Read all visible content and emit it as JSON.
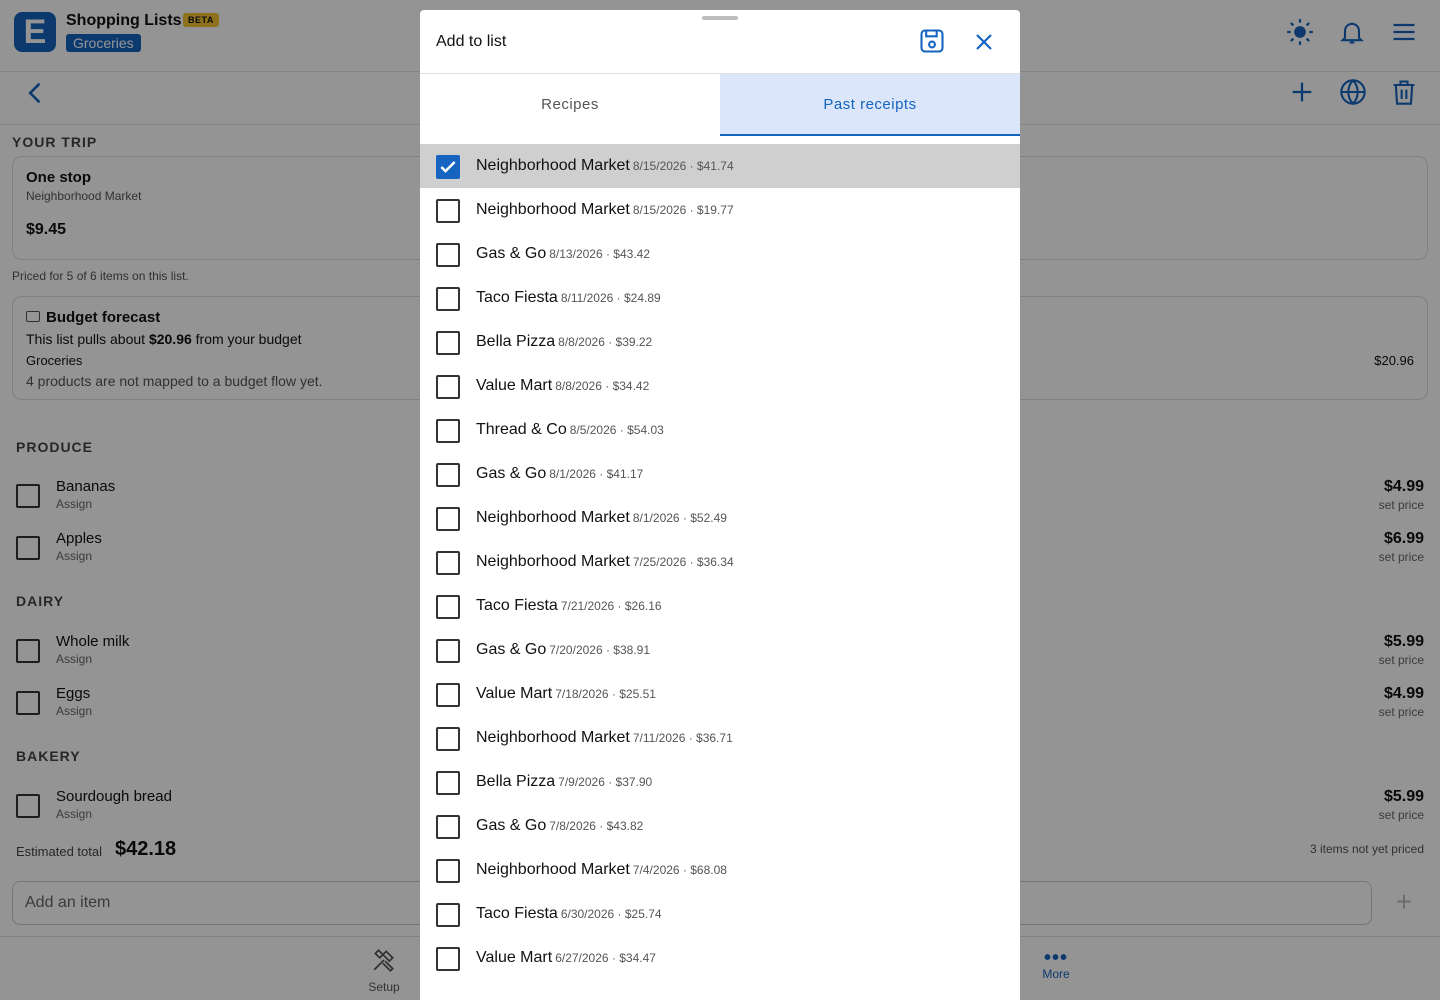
{
  "app": {
    "title": "Shopping Lists",
    "beta_label": "BETA",
    "list_name": "Groceries"
  },
  "trip": {
    "section_label": "YOUR TRIP",
    "title": "One stop",
    "store": "Neighborhood Market",
    "price": "$9.45",
    "priced_note": "Priced for 5 of 6 items on this list."
  },
  "budget": {
    "title": "Budget forecast",
    "line_prefix": "This list pulls about",
    "line_amount": "$20.96",
    "line_suffix": "from your budget",
    "category": "Groceries",
    "category_amount": "$20.96",
    "warning": "4 products are not mapped to a budget flow yet."
  },
  "categories": [
    {
      "label": "PRODUCE"
    },
    {
      "label": "DAIRY"
    },
    {
      "label": "BAKERY"
    }
  ],
  "items": [
    {
      "name": "Bananas",
      "assign": "Assign",
      "price": "$4.99",
      "price_note": "set price"
    },
    {
      "name": "Apples",
      "assign": "Assign",
      "price": "$6.99",
      "price_note": "set price"
    },
    {
      "name": "Whole milk",
      "assign": "Assign",
      "price": "$5.99",
      "price_note": "set price"
    },
    {
      "name": "Eggs",
      "assign": "Assign",
      "price": "$4.99",
      "price_note": "set price"
    },
    {
      "name": "Sourdough bread",
      "assign": "Assign",
      "price": "$5.99",
      "price_note": "set price"
    }
  ],
  "totals": {
    "estimated_label": "Estimated total",
    "estimated_value": "$42.18",
    "not_priced": "3 items not yet priced"
  },
  "add_item": {
    "placeholder": "Add an item"
  },
  "bottom_nav": {
    "setup": "Setup",
    "more": "More"
  },
  "modal": {
    "title": "Add to list",
    "tabs": [
      {
        "label": "Recipes",
        "active": false
      },
      {
        "label": "Past receipts",
        "active": true
      }
    ],
    "receipts": [
      {
        "store": "Neighborhood Market",
        "meta": "8/15/2026 · $41.74",
        "checked": true
      },
      {
        "store": "Neighborhood Market",
        "meta": "8/15/2026 · $19.77",
        "checked": false
      },
      {
        "store": "Gas & Go",
        "meta": "8/13/2026 · $43.42",
        "checked": false
      },
      {
        "store": "Taco Fiesta",
        "meta": "8/11/2026 · $24.89",
        "checked": false
      },
      {
        "store": "Bella Pizza",
        "meta": "8/8/2026 · $39.22",
        "checked": false
      },
      {
        "store": "Value Mart",
        "meta": "8/8/2026 · $34.42",
        "checked": false
      },
      {
        "store": "Thread & Co",
        "meta": "8/5/2026 · $54.03",
        "checked": false
      },
      {
        "store": "Gas & Go",
        "meta": "8/1/2026 · $41.17",
        "checked": false
      },
      {
        "store": "Neighborhood Market",
        "meta": "8/1/2026 · $52.49",
        "checked": false
      },
      {
        "store": "Neighborhood Market",
        "meta": "7/25/2026 · $36.34",
        "checked": false
      },
      {
        "store": "Taco Fiesta",
        "meta": "7/21/2026 · $26.16",
        "checked": false
      },
      {
        "store": "Gas & Go",
        "meta": "7/20/2026 · $38.91",
        "checked": false
      },
      {
        "store": "Value Mart",
        "meta": "7/18/2026 · $25.51",
        "checked": false
      },
      {
        "store": "Neighborhood Market",
        "meta": "7/11/2026 · $36.71",
        "checked": false
      },
      {
        "store": "Bella Pizza",
        "meta": "7/9/2026 · $37.90",
        "checked": false
      },
      {
        "store": "Gas & Go",
        "meta": "7/8/2026 · $43.82",
        "checked": false
      },
      {
        "store": "Neighborhood Market",
        "meta": "7/4/2026 · $68.08",
        "checked": false
      },
      {
        "store": "Taco Fiesta",
        "meta": "6/30/2026 · $25.74",
        "checked": false
      },
      {
        "store": "Value Mart",
        "meta": "6/27/2026 · $34.47",
        "checked": false
      }
    ]
  },
  "colors": {
    "accent": "#1565c0",
    "tab_active_bg": "#dbe6fb",
    "beta": "#f4c430",
    "selected_row": "#cfcfcf"
  },
  "icons": [
    "logo-icon",
    "sun-icon",
    "bell-icon",
    "menu-icon",
    "back-icon",
    "plus-icon",
    "globe-icon",
    "trash-icon",
    "wallet-icon",
    "save-icon",
    "close-icon",
    "check-icon",
    "tools-icon",
    "more-icon"
  ]
}
